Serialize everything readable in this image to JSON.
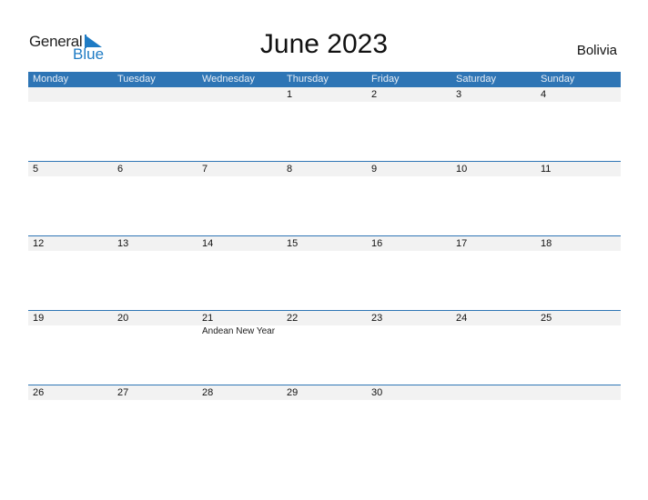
{
  "logo": {
    "line1": "General",
    "line2": "Blue"
  },
  "title": "June 2023",
  "country": "Bolivia",
  "colors": {
    "header_bg": "#2e75b5",
    "date_row_bg": "#f2f2f2",
    "brand_blue": "#1e7bc4"
  },
  "weekdays": [
    "Monday",
    "Tuesday",
    "Wednesday",
    "Thursday",
    "Friday",
    "Saturday",
    "Sunday"
  ],
  "weeks": [
    {
      "dates": [
        "",
        "",
        "",
        "1",
        "2",
        "3",
        "4"
      ],
      "events": [
        "",
        "",
        "",
        "",
        "",
        "",
        ""
      ]
    },
    {
      "dates": [
        "5",
        "6",
        "7",
        "8",
        "9",
        "10",
        "11"
      ],
      "events": [
        "",
        "",
        "",
        "",
        "",
        "",
        ""
      ]
    },
    {
      "dates": [
        "12",
        "13",
        "14",
        "15",
        "16",
        "17",
        "18"
      ],
      "events": [
        "",
        "",
        "",
        "",
        "",
        "",
        ""
      ]
    },
    {
      "dates": [
        "19",
        "20",
        "21",
        "22",
        "23",
        "24",
        "25"
      ],
      "events": [
        "",
        "",
        "Andean New Year",
        "",
        "",
        "",
        ""
      ]
    },
    {
      "dates": [
        "26",
        "27",
        "28",
        "29",
        "30",
        "",
        ""
      ],
      "events": [
        "",
        "",
        "",
        "",
        "",
        "",
        ""
      ]
    }
  ]
}
